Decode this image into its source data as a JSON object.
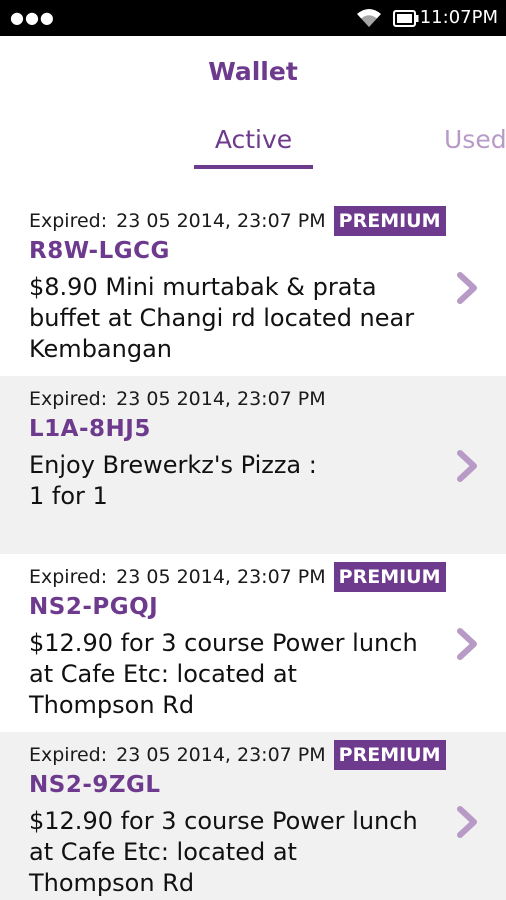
{
  "status_bar": {
    "menu_icon": "dots-icon",
    "wifi_icon": "wifi-icon",
    "battery_icon": "battery-icon",
    "time": "11:07PM"
  },
  "header": {
    "title": "Wallet"
  },
  "tabs": [
    {
      "label": "Active",
      "selected": true
    },
    {
      "label": "Used",
      "selected": false
    }
  ],
  "colors": {
    "accent": "#6d3a8e",
    "tab_inactive": "#b89ac9",
    "alt_row": "#f1f1f1",
    "chevron": "#b79bc6"
  },
  "vouchers": [
    {
      "expiry_label": "Expired:",
      "expiry_date": "23 05 2014, 23:07 PM",
      "badge": "PREMIUM",
      "code": "R8W-LGCG",
      "description": "$8.90 Mini murtabak & prata buffet at Changi rd located near Kembangan"
    },
    {
      "expiry_label": "Expired:",
      "expiry_date": "23 05 2014, 23:07 PM",
      "badge": "",
      "code": "L1A-8HJ5",
      "description": "Enjoy Brewerkz's Pizza : 1 for 1"
    },
    {
      "expiry_label": "Expired:",
      "expiry_date": "23 05 2014, 23:07 PM",
      "badge": "PREMIUM",
      "code": "NS2-PGQJ",
      "description": "$12.90 for 3 course Power lunch at Cafe Etc: located at Thompson Rd"
    },
    {
      "expiry_label": "Expired:",
      "expiry_date": "23 05 2014, 23:07 PM",
      "badge": "PREMIUM",
      "code": "NS2-9ZGL",
      "description": "$12.90 for 3 course Power lunch at Cafe Etc: located at Thompson Rd"
    }
  ]
}
